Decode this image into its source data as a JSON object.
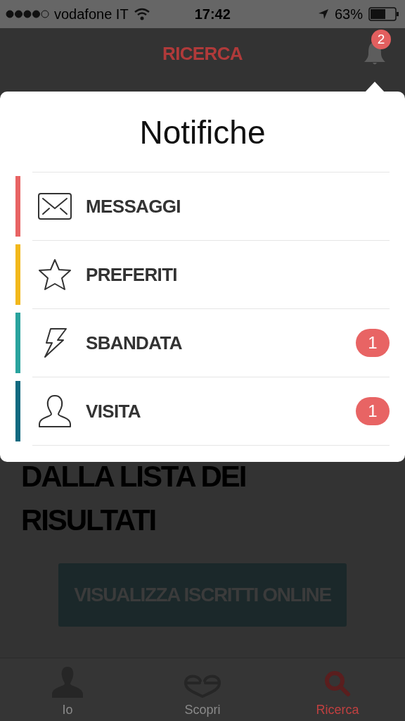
{
  "status_bar": {
    "carrier": "vodafone IT",
    "time": "17:42",
    "battery": "63%"
  },
  "nav": {
    "title": "RICERCA",
    "bell_badge": "2"
  },
  "content": {
    "headline": "DALLA LISTA DEI RISULTATI",
    "button": "VISUALIZZA ISCRITTI ONLINE"
  },
  "popover": {
    "title": "Notifiche",
    "items": [
      {
        "kind": "envelope",
        "label": "MESSAGGI",
        "color": "#e86464"
      },
      {
        "kind": "star",
        "label": "PREFERITI",
        "color": "#f2b81c"
      },
      {
        "kind": "bolt",
        "label": "SBANDATA",
        "color": "#2aa39e",
        "count": "1"
      },
      {
        "kind": "person",
        "label": "VISITA",
        "color": "#116a80",
        "count": "1"
      }
    ]
  },
  "tabs": [
    {
      "kind": "person",
      "label": "Io",
      "selected": false
    },
    {
      "kind": "hearts",
      "label": "Scopri",
      "selected": false
    },
    {
      "kind": "search",
      "label": "Ricerca",
      "selected": true
    }
  ]
}
